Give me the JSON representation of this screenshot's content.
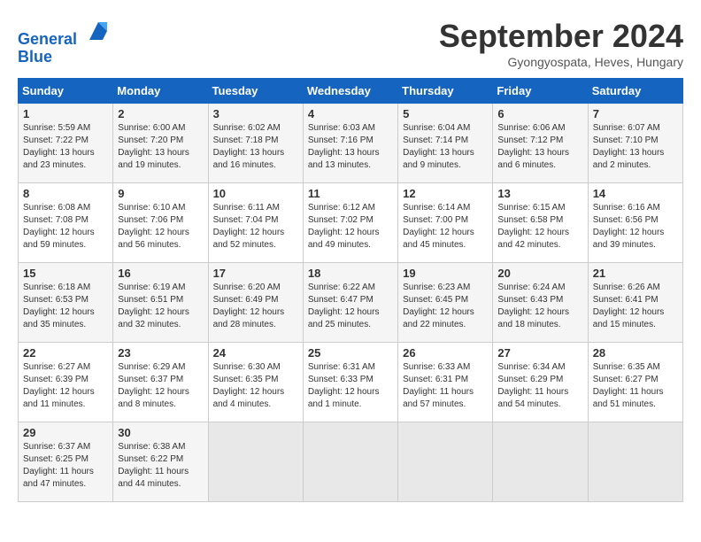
{
  "header": {
    "logo_line1": "General",
    "logo_line2": "Blue",
    "month_title": "September 2024",
    "subtitle": "Gyongyospata, Heves, Hungary"
  },
  "weekdays": [
    "Sunday",
    "Monday",
    "Tuesday",
    "Wednesday",
    "Thursday",
    "Friday",
    "Saturday"
  ],
  "weeks": [
    [
      {
        "day": "1",
        "detail": "Sunrise: 5:59 AM\nSunset: 7:22 PM\nDaylight: 13 hours\nand 23 minutes."
      },
      {
        "day": "2",
        "detail": "Sunrise: 6:00 AM\nSunset: 7:20 PM\nDaylight: 13 hours\nand 19 minutes."
      },
      {
        "day": "3",
        "detail": "Sunrise: 6:02 AM\nSunset: 7:18 PM\nDaylight: 13 hours\nand 16 minutes."
      },
      {
        "day": "4",
        "detail": "Sunrise: 6:03 AM\nSunset: 7:16 PM\nDaylight: 13 hours\nand 13 minutes."
      },
      {
        "day": "5",
        "detail": "Sunrise: 6:04 AM\nSunset: 7:14 PM\nDaylight: 13 hours\nand 9 minutes."
      },
      {
        "day": "6",
        "detail": "Sunrise: 6:06 AM\nSunset: 7:12 PM\nDaylight: 13 hours\nand 6 minutes."
      },
      {
        "day": "7",
        "detail": "Sunrise: 6:07 AM\nSunset: 7:10 PM\nDaylight: 13 hours\nand 2 minutes."
      }
    ],
    [
      {
        "day": "8",
        "detail": "Sunrise: 6:08 AM\nSunset: 7:08 PM\nDaylight: 12 hours\nand 59 minutes."
      },
      {
        "day": "9",
        "detail": "Sunrise: 6:10 AM\nSunset: 7:06 PM\nDaylight: 12 hours\nand 56 minutes."
      },
      {
        "day": "10",
        "detail": "Sunrise: 6:11 AM\nSunset: 7:04 PM\nDaylight: 12 hours\nand 52 minutes."
      },
      {
        "day": "11",
        "detail": "Sunrise: 6:12 AM\nSunset: 7:02 PM\nDaylight: 12 hours\nand 49 minutes."
      },
      {
        "day": "12",
        "detail": "Sunrise: 6:14 AM\nSunset: 7:00 PM\nDaylight: 12 hours\nand 45 minutes."
      },
      {
        "day": "13",
        "detail": "Sunrise: 6:15 AM\nSunset: 6:58 PM\nDaylight: 12 hours\nand 42 minutes."
      },
      {
        "day": "14",
        "detail": "Sunrise: 6:16 AM\nSunset: 6:56 PM\nDaylight: 12 hours\nand 39 minutes."
      }
    ],
    [
      {
        "day": "15",
        "detail": "Sunrise: 6:18 AM\nSunset: 6:53 PM\nDaylight: 12 hours\nand 35 minutes."
      },
      {
        "day": "16",
        "detail": "Sunrise: 6:19 AM\nSunset: 6:51 PM\nDaylight: 12 hours\nand 32 minutes."
      },
      {
        "day": "17",
        "detail": "Sunrise: 6:20 AM\nSunset: 6:49 PM\nDaylight: 12 hours\nand 28 minutes."
      },
      {
        "day": "18",
        "detail": "Sunrise: 6:22 AM\nSunset: 6:47 PM\nDaylight: 12 hours\nand 25 minutes."
      },
      {
        "day": "19",
        "detail": "Sunrise: 6:23 AM\nSunset: 6:45 PM\nDaylight: 12 hours\nand 22 minutes."
      },
      {
        "day": "20",
        "detail": "Sunrise: 6:24 AM\nSunset: 6:43 PM\nDaylight: 12 hours\nand 18 minutes."
      },
      {
        "day": "21",
        "detail": "Sunrise: 6:26 AM\nSunset: 6:41 PM\nDaylight: 12 hours\nand 15 minutes."
      }
    ],
    [
      {
        "day": "22",
        "detail": "Sunrise: 6:27 AM\nSunset: 6:39 PM\nDaylight: 12 hours\nand 11 minutes."
      },
      {
        "day": "23",
        "detail": "Sunrise: 6:29 AM\nSunset: 6:37 PM\nDaylight: 12 hours\nand 8 minutes."
      },
      {
        "day": "24",
        "detail": "Sunrise: 6:30 AM\nSunset: 6:35 PM\nDaylight: 12 hours\nand 4 minutes."
      },
      {
        "day": "25",
        "detail": "Sunrise: 6:31 AM\nSunset: 6:33 PM\nDaylight: 12 hours\nand 1 minute."
      },
      {
        "day": "26",
        "detail": "Sunrise: 6:33 AM\nSunset: 6:31 PM\nDaylight: 11 hours\nand 57 minutes."
      },
      {
        "day": "27",
        "detail": "Sunrise: 6:34 AM\nSunset: 6:29 PM\nDaylight: 11 hours\nand 54 minutes."
      },
      {
        "day": "28",
        "detail": "Sunrise: 6:35 AM\nSunset: 6:27 PM\nDaylight: 11 hours\nand 51 minutes."
      }
    ],
    [
      {
        "day": "29",
        "detail": "Sunrise: 6:37 AM\nSunset: 6:25 PM\nDaylight: 11 hours\nand 47 minutes."
      },
      {
        "day": "30",
        "detail": "Sunrise: 6:38 AM\nSunset: 6:22 PM\nDaylight: 11 hours\nand 44 minutes."
      },
      {
        "day": "",
        "detail": ""
      },
      {
        "day": "",
        "detail": ""
      },
      {
        "day": "",
        "detail": ""
      },
      {
        "day": "",
        "detail": ""
      },
      {
        "day": "",
        "detail": ""
      }
    ]
  ]
}
